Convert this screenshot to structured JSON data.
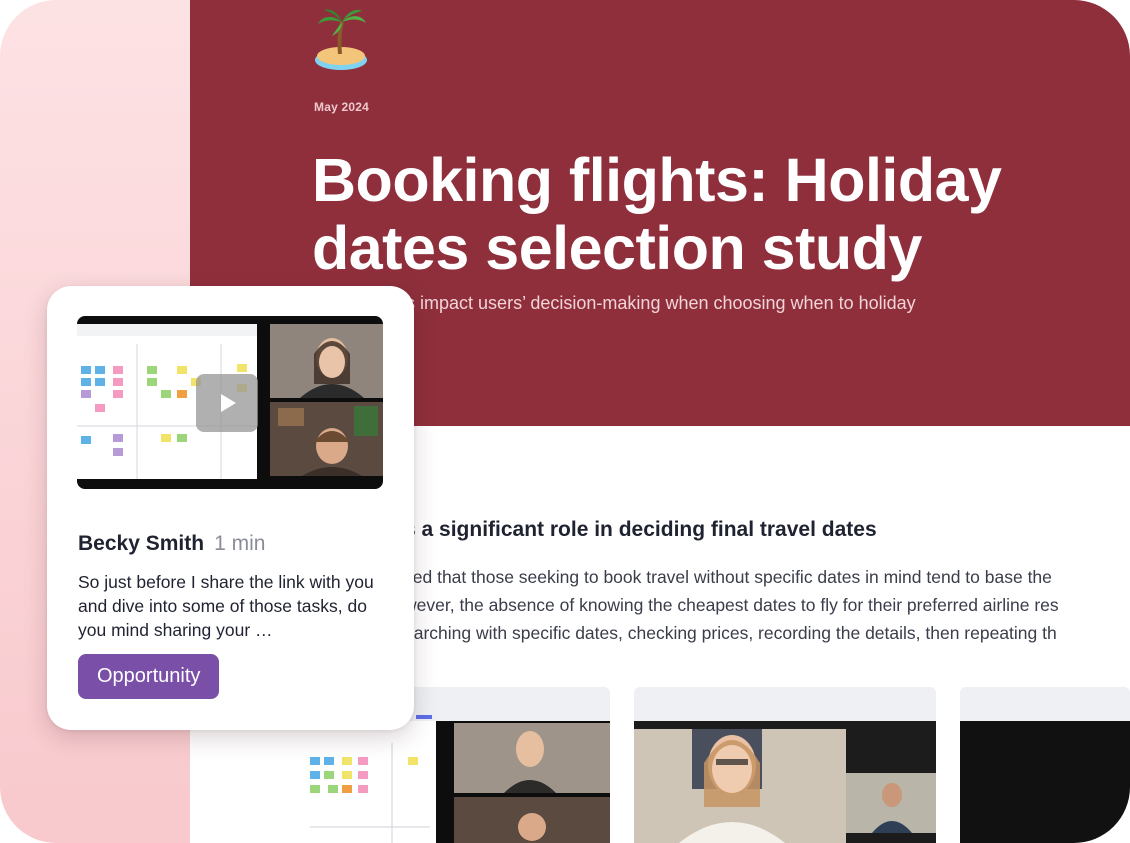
{
  "hero": {
    "icon": "desert-island-icon",
    "date": "May 2024",
    "title": "Booking flights: Holiday dates selection study",
    "subtitle": "What factors impact users’ decision-making when choosing when to holiday"
  },
  "finding": {
    "heading": "s a significant role in deciding final travel dates",
    "lines": [
      "ved that those seeking to book travel without specific dates in mind tend to base the",
      "wever, the absence of knowing the cheapest dates to fly for their preferred airline res",
      "earching with specific dates, checking prices, recording the details, then repeating th"
    ]
  },
  "clip": {
    "author": "Becky Smith",
    "duration": "1 min",
    "quote": "So just before I share the link with you and dive into some of those tasks, do you mind sharing your …",
    "tag": "Opportunity",
    "play_icon": "play-icon"
  },
  "colors": {
    "hero_bg": "#8f2f3c",
    "side_panel": "#fde2e4",
    "tag_bg": "#7a4fa8"
  }
}
